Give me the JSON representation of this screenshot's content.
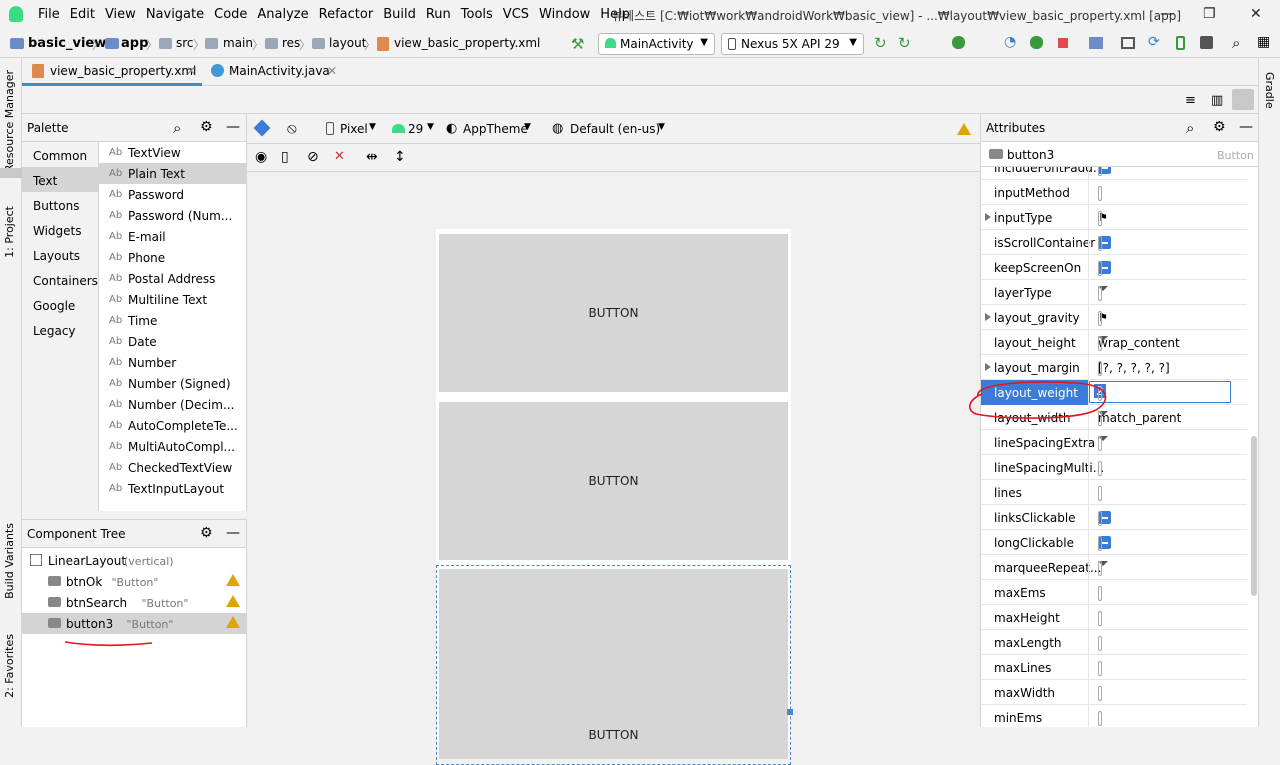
{
  "menubar": {
    "items": [
      "File",
      "Edit",
      "View",
      "Navigate",
      "Code",
      "Analyze",
      "Refactor",
      "Build",
      "Run",
      "Tools",
      "VCS",
      "Window",
      "Help"
    ],
    "title": "뷰테스트 [C:₩iot₩work₩androidWork₩basic_view] - ...₩layout₩view_basic_property.xml [app]"
  },
  "navbar": {
    "breadcrumbs": [
      "basic_view",
      "app",
      "src",
      "main",
      "res",
      "layout",
      "view_basic_property.xml"
    ],
    "run_config": "MainActivity",
    "device": "Nexus 5X API 29"
  },
  "tabs": [
    {
      "label": "view_basic_property.xml"
    },
    {
      "label": "MainActivity.java"
    }
  ],
  "side_tabs": {
    "left": [
      "Resource Manager",
      "1: Project",
      "Build Variants",
      "2: Favorites"
    ],
    "right": [
      "Gradle"
    ]
  },
  "palette": {
    "title": "Palette",
    "categories": [
      "Common",
      "Text",
      "Buttons",
      "Widgets",
      "Layouts",
      "Containers",
      "Google",
      "Legacy"
    ],
    "selected_category": "Text",
    "widgets": [
      "TextView",
      "Plain Text",
      "Password",
      "Password (Num...",
      "E-mail",
      "Phone",
      "Postal Address",
      "Multiline Text",
      "Time",
      "Date",
      "Number",
      "Number (Signed)",
      "Number (Decim...",
      "AutoCompleteTe...",
      "MultiAutoCompl...",
      "CheckedTextView",
      "TextInputLayout"
    ],
    "widget_prefix": "Ab",
    "selected_widget": "Plain Text"
  },
  "component_tree": {
    "title": "Component Tree",
    "root": {
      "name": "LinearLayout",
      "detail": "(vertical)"
    },
    "children": [
      {
        "name": "btnOk",
        "text": "\"Button\""
      },
      {
        "name": "btnSearch",
        "text": "\"Button\""
      },
      {
        "name": "button3",
        "text": "\"Button\""
      }
    ]
  },
  "design_toolbar": {
    "device": "Pixel",
    "api": "29",
    "theme": "AppTheme",
    "locale": "Default (en-us)"
  },
  "canvas": {
    "buttons": [
      "BUTTON",
      "BUTTON",
      "BUTTON"
    ]
  },
  "attributes": {
    "title": "Attributes",
    "component_id": "button3",
    "component_type": "Button",
    "rows": [
      {
        "name": "includeFontPadd...",
        "type": "checkbox"
      },
      {
        "name": "inputMethod",
        "type": "text",
        "value": ""
      },
      {
        "name": "inputType",
        "type": "flag",
        "expand": true
      },
      {
        "name": "isScrollContainer",
        "type": "checkbox"
      },
      {
        "name": "keepScreenOn",
        "type": "checkbox"
      },
      {
        "name": "layerType",
        "type": "dropdown",
        "value": ""
      },
      {
        "name": "layout_gravity",
        "type": "flag",
        "expand": true
      },
      {
        "name": "layout_height",
        "type": "dropdown",
        "value": "wrap_content"
      },
      {
        "name": "layout_margin",
        "type": "text",
        "value": "[?, ?, ?, ?, ?]",
        "expand": true
      },
      {
        "name": "layout_weight",
        "type": "edit",
        "value": "2",
        "selected": true
      },
      {
        "name": "layout_width",
        "type": "dropdown",
        "value": "match_parent"
      },
      {
        "name": "lineSpacingExtra",
        "type": "dropdown",
        "value": ""
      },
      {
        "name": "lineSpacingMulti...",
        "type": "text",
        "value": ""
      },
      {
        "name": "lines",
        "type": "text",
        "value": ""
      },
      {
        "name": "linksClickable",
        "type": "checkbox"
      },
      {
        "name": "longClickable",
        "type": "checkbox"
      },
      {
        "name": "marqueeRepeat...",
        "type": "dropdown",
        "value": ""
      },
      {
        "name": "maxEms",
        "type": "text",
        "value": ""
      },
      {
        "name": "maxHeight",
        "type": "text",
        "value": ""
      },
      {
        "name": "maxLength",
        "type": "text",
        "value": ""
      },
      {
        "name": "maxLines",
        "type": "text",
        "value": ""
      },
      {
        "name": "maxWidth",
        "type": "text",
        "value": ""
      },
      {
        "name": "minEms",
        "type": "text",
        "value": ""
      }
    ]
  },
  "colors": {
    "accent": "#3d7cd6",
    "annotation": "#e0161d",
    "warning": "#e0a400",
    "selection": "#3d7cd6"
  }
}
